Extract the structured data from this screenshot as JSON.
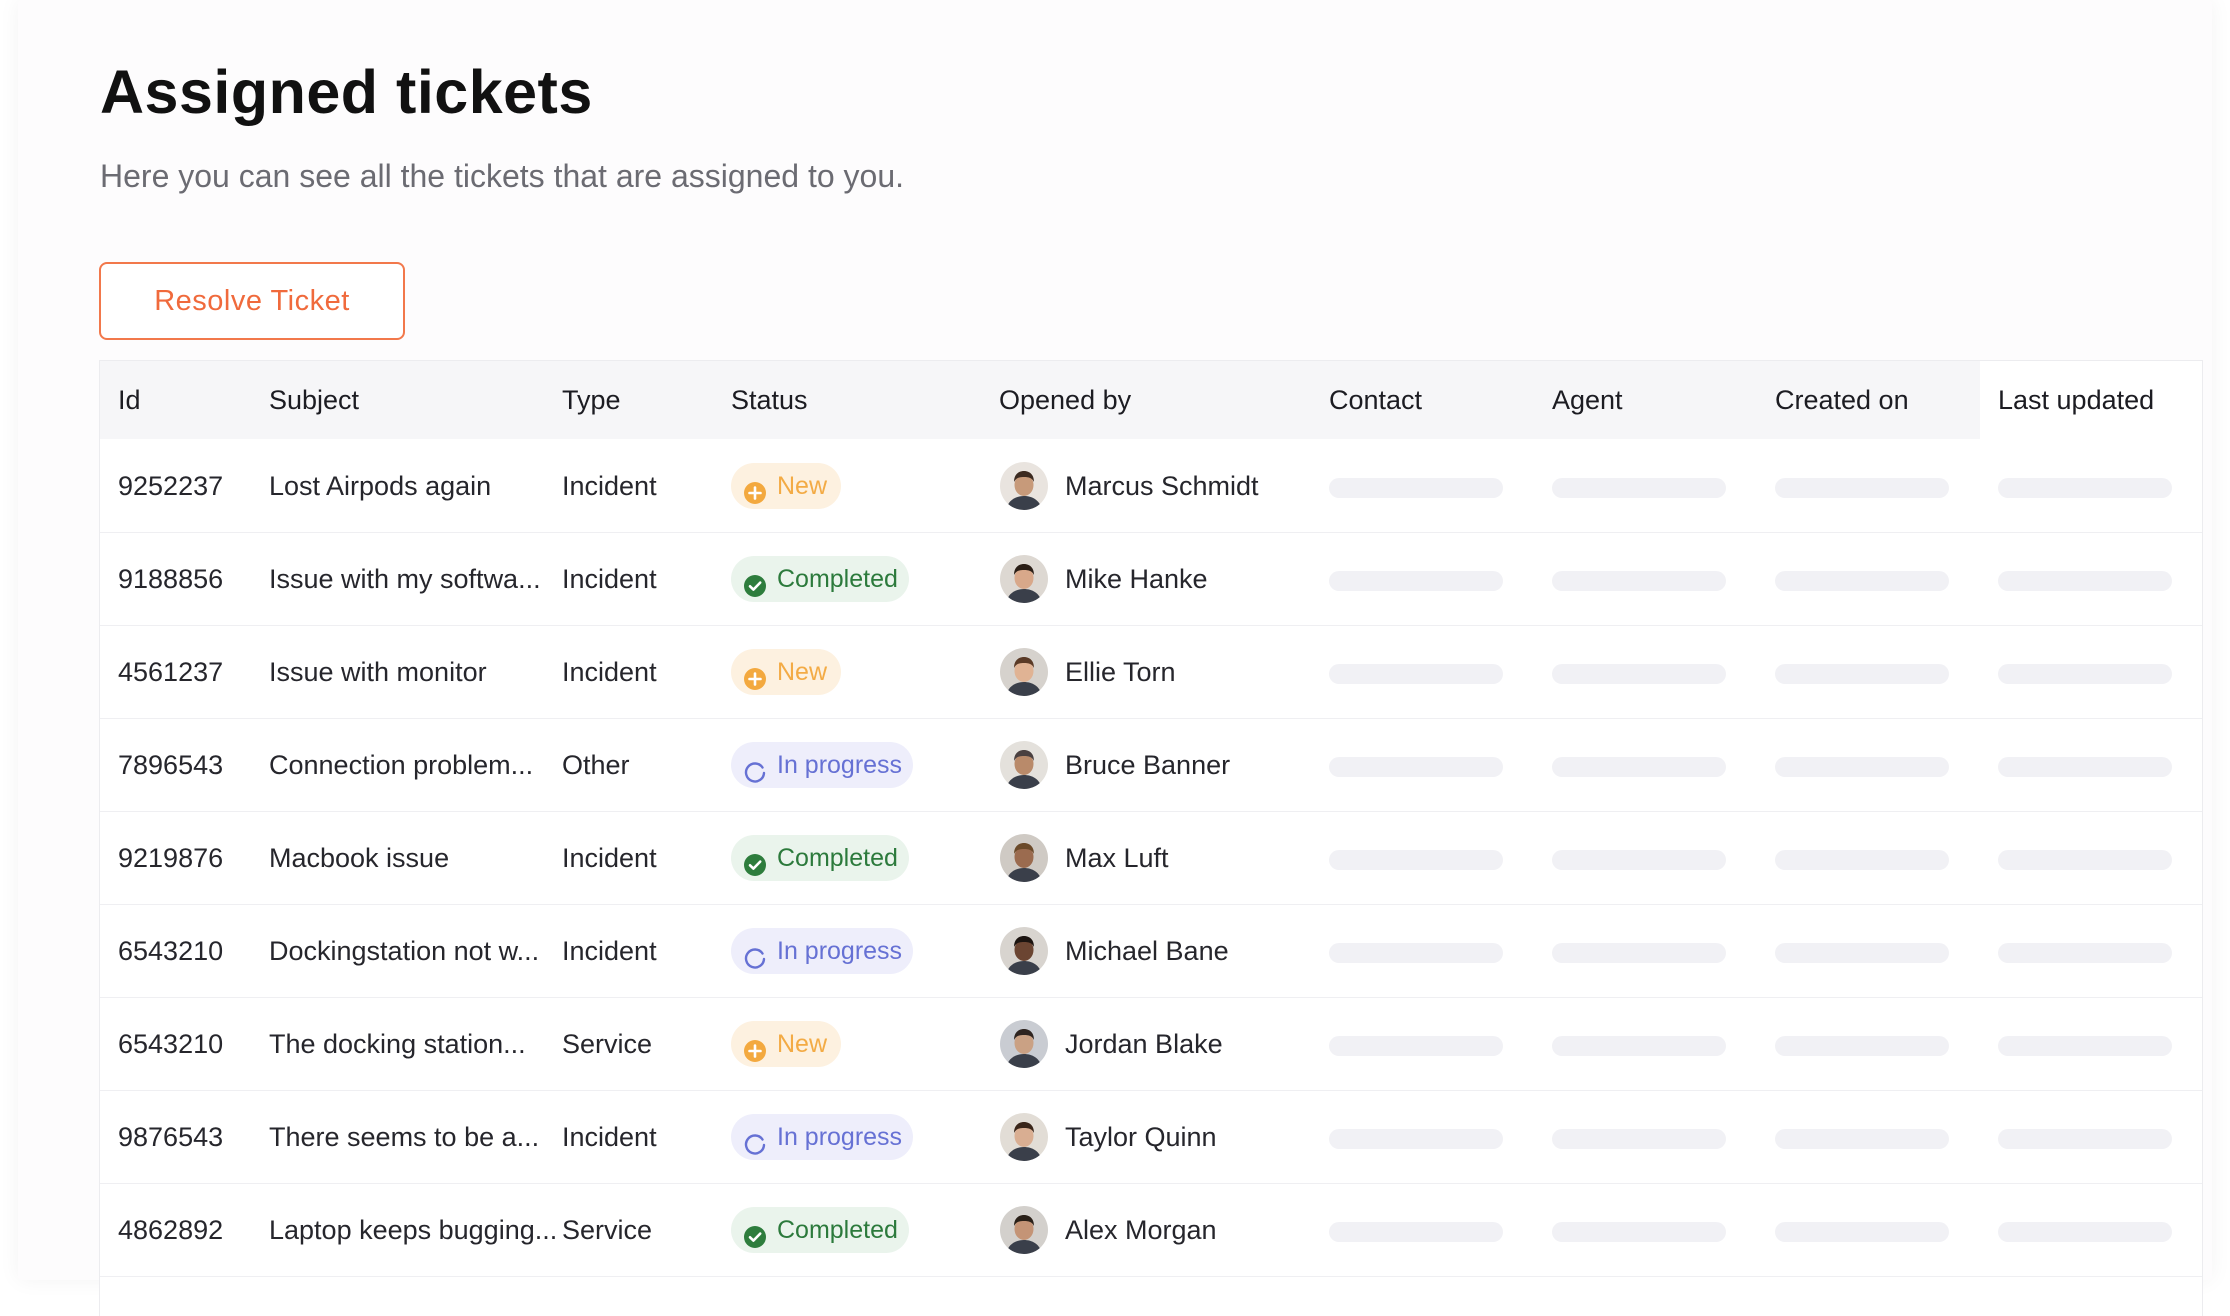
{
  "page": {
    "title": "Assigned tickets",
    "subtitle": "Here you can see all the tickets that are assigned to you.",
    "resolve_button_label": "Resolve Ticket"
  },
  "table": {
    "columns": [
      "Id",
      "Subject",
      "Type",
      "Status",
      "Opened by",
      "Contact",
      "Agent",
      "Created on",
      "Last updated"
    ],
    "rows": [
      {
        "id": "9252237",
        "subject": "Lost Airpods again",
        "type": "Incident",
        "status": "New",
        "status_kind": "new",
        "opened_by": "Marcus Schmidt"
      },
      {
        "id": "9188856",
        "subject": "Issue with my softwa...",
        "type": "Incident",
        "status": "Completed",
        "status_kind": "completed",
        "opened_by": "Mike Hanke"
      },
      {
        "id": "4561237",
        "subject": "Issue with monitor",
        "type": "Incident",
        "status": "New",
        "status_kind": "new",
        "opened_by": "Ellie Torn"
      },
      {
        "id": "7896543",
        "subject": "Connection problem...",
        "type": "Other",
        "status": "In progress",
        "status_kind": "progress",
        "opened_by": "Bruce Banner"
      },
      {
        "id": "9219876",
        "subject": "Macbook issue",
        "type": "Incident",
        "status": "Completed",
        "status_kind": "completed",
        "opened_by": "Max Luft"
      },
      {
        "id": "6543210",
        "subject": "Dockingstation not w...",
        "type": "Incident",
        "status": "In progress",
        "status_kind": "progress",
        "opened_by": "Michael Bane"
      },
      {
        "id": "6543210",
        "subject": "The docking station...",
        "type": "Service",
        "status": "New",
        "status_kind": "new",
        "opened_by": "Jordan Blake"
      },
      {
        "id": "9876543",
        "subject": "There seems to be a...",
        "type": "Incident",
        "status": "In progress",
        "status_kind": "progress",
        "opened_by": "Taylor Quinn"
      },
      {
        "id": "4862892",
        "subject": "Laptop keeps bugging...",
        "type": "Service",
        "status": "Completed",
        "status_kind": "completed",
        "opened_by": "Alex Morgan"
      }
    ]
  },
  "icons": {
    "new": "plus-circle-icon",
    "completed": "check-circle-icon",
    "progress": "progress-spinner-icon",
    "avatar": "user-avatar"
  },
  "colors": {
    "accent": "#f06a3c",
    "new_bg": "#fdf1e0",
    "new_fg": "#f3ab45",
    "completed_bg": "#eaf4ec",
    "completed_fg": "#2c7a3c",
    "progress_bg": "#eeeefb",
    "progress_fg": "#6671d4",
    "skeleton": "#f1f1f5"
  }
}
